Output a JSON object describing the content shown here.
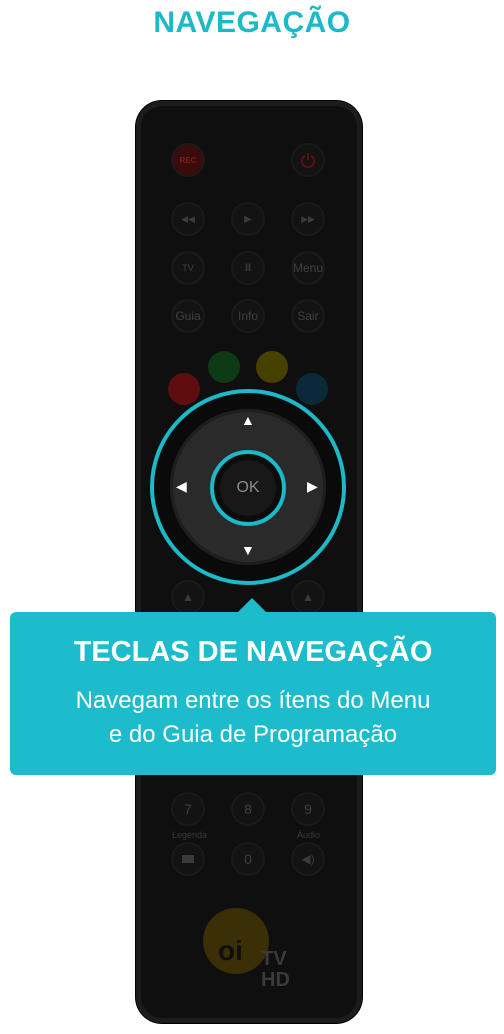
{
  "header": {
    "title": "NAVEGAÇÃO"
  },
  "remote": {
    "rec_label": "REC",
    "power_icon": "power-icon",
    "transport": [
      "◀◀",
      "▶",
      "▶▶"
    ],
    "row2": {
      "tv_label": "TV",
      "pause": "II",
      "menu": "Menu"
    },
    "row3": [
      "Guia",
      "Info",
      "Sair"
    ],
    "colors": {
      "red": "#6a1010",
      "green": "#0f3d16",
      "yellow": "#4a4400",
      "blue": "#0a2b3c"
    },
    "ok_label": "OK",
    "keypad": {
      "row_bottom": [
        "7",
        "8",
        "9"
      ],
      "legenda": "Legenda",
      "audio": "Áudio",
      "zero": "0"
    },
    "logo": {
      "oi": "oi",
      "tv": "TV",
      "hd": "HD"
    }
  },
  "callout": {
    "title": "TECLAS DE NAVEGAÇÃO",
    "description": "Navegam entre os ítens do Menu\ne do Guia de Programação"
  },
  "colors": {
    "accent": "#1cb9c8"
  }
}
